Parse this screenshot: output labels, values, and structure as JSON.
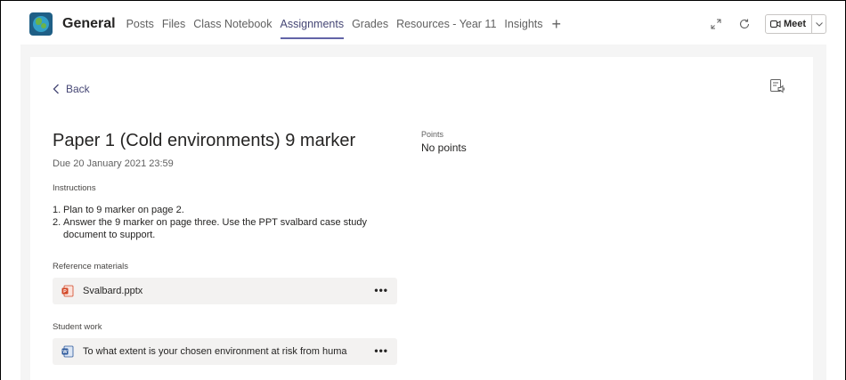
{
  "header": {
    "channel_name": "General",
    "tabs": [
      {
        "label": "Posts"
      },
      {
        "label": "Files"
      },
      {
        "label": "Class Notebook"
      },
      {
        "label": "Assignments",
        "active": true
      },
      {
        "label": "Grades"
      },
      {
        "label": "Resources - Year 11"
      },
      {
        "label": "Insights"
      }
    ],
    "add_tab": "+",
    "meet_label": "Meet"
  },
  "assignment": {
    "back_label": "Back",
    "title": "Paper 1 (Cold environments) 9 marker",
    "due": "Due 20 January 2021 23:59",
    "points_label": "Points",
    "points_value": "No points",
    "instructions_label": "Instructions",
    "instructions": [
      {
        "num": "1.",
        "text": "Plan to 9 marker on page 2."
      },
      {
        "num": "2.",
        "text": "Answer the 9 marker on page three. Use the PPT svalbard case study document to support."
      }
    ],
    "reference_label": "Reference materials",
    "reference_file": "Svalbard.pptx",
    "student_work_label": "Student work",
    "student_file": "To what extent is your chosen environment at risk from huma",
    "more_label": "•••"
  },
  "colors": {
    "accent": "#6264a7",
    "accent_text": "#464775",
    "card_bg": "#ffffff",
    "page_bg": "#f5f5f5",
    "attachment_bg": "#f3f2f1",
    "ppt_red": "#d24726",
    "word_blue": "#2b579a"
  },
  "icons": {
    "team_logo": "globe-icon",
    "expand": "expand-icon",
    "refresh": "refresh-icon",
    "meet": "video-camera-icon",
    "chevron": "chevron-down-icon",
    "back": "chevron-left-icon",
    "immersive_reader": "immersive-reader-icon",
    "ppt": "powerpoint-file-icon",
    "doc": "word-file-icon"
  }
}
